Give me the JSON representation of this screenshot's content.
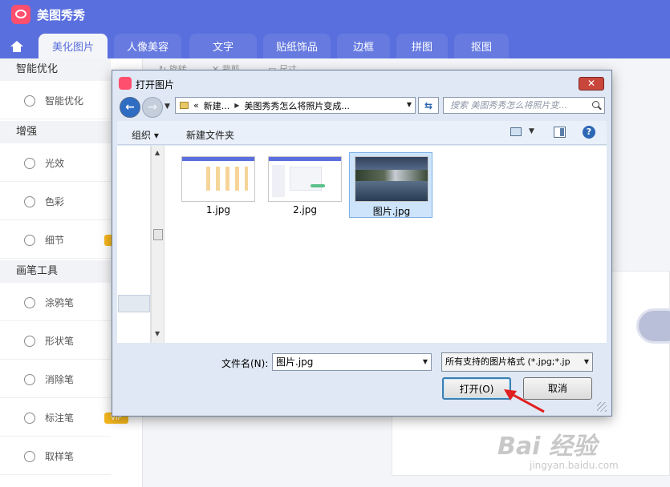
{
  "app": {
    "title": "美图秀秀"
  },
  "nav": {
    "tabs": [
      {
        "label": "美化图片",
        "active": true
      },
      {
        "label": "人像美容"
      },
      {
        "label": "文字"
      },
      {
        "label": "贴纸饰品"
      },
      {
        "label": "边框"
      },
      {
        "label": "拼图"
      },
      {
        "label": "抠图"
      }
    ]
  },
  "sidebar": {
    "groups": [
      {
        "title": "智能优化",
        "items": [
          {
            "label": "智能优化",
            "icon": "bulb-icon"
          }
        ]
      },
      {
        "title": "增强",
        "items": [
          {
            "label": "光效",
            "icon": "sun-icon"
          },
          {
            "label": "色彩",
            "icon": "palette-icon"
          },
          {
            "label": "细节",
            "icon": "magnifier-icon"
          }
        ]
      },
      {
        "title": "画笔工具",
        "items": [
          {
            "label": "涂鸦笔",
            "icon": "spray-icon"
          },
          {
            "label": "形状笔",
            "icon": "shapes-icon"
          },
          {
            "label": "消除笔",
            "icon": "eraser-icon"
          },
          {
            "label": "标注笔",
            "icon": "marker-icon",
            "badge": "VIP"
          },
          {
            "label": "取样笔",
            "icon": "eyedropper-icon"
          }
        ]
      }
    ]
  },
  "toolbar_peek": {
    "rotate": "旋转",
    "crop": "裁剪",
    "size": "尺寸"
  },
  "dialog": {
    "title": "打开图片",
    "close_label": "✕",
    "address": {
      "prefix": "«",
      "crumb1": "新建...",
      "crumb2": "美图秀秀怎么将照片变成..."
    },
    "search_placeholder": "搜索 美图秀秀怎么将照片变...",
    "organize_label": "组织 ▾",
    "new_folder_label": "新建文件夹",
    "help_label": "?",
    "files": [
      {
        "name": "1.jpg",
        "selected": false
      },
      {
        "name": "2.jpg",
        "selected": false
      },
      {
        "name": "图片.jpg",
        "selected": true
      }
    ],
    "filename_label": "文件名(N):",
    "filename_value": "图片.jpg",
    "filetype_value": "所有支持的图片格式 (*.jpg;*.jp",
    "open_label": "打开(O)",
    "cancel_label": "取消"
  },
  "watermark": {
    "main": "Bai 经验",
    "sub": "jingyan.baidu.com"
  },
  "colors": {
    "brand": "#5a6fde",
    "vip": "#f6b81d",
    "logo": "#ff4f6e",
    "selected": "#cde4fa"
  }
}
